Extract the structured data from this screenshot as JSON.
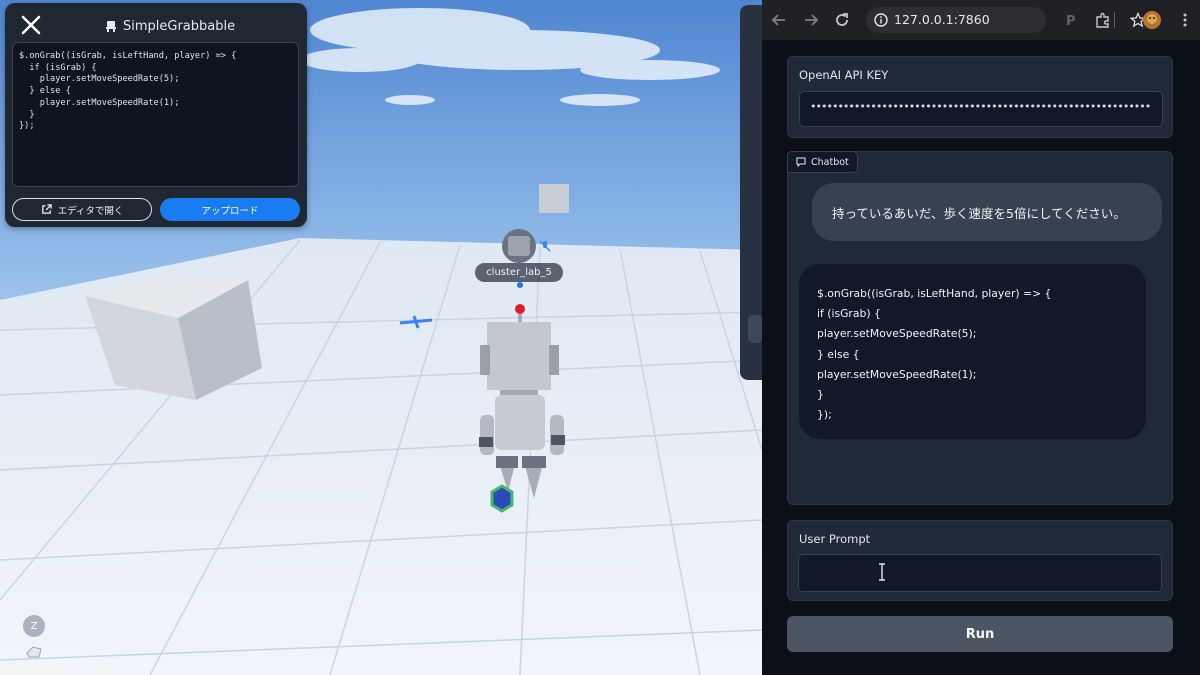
{
  "scene": {
    "grab_panel": {
      "title": "SimpleGrabbable",
      "code": "$.onGrab((isGrab, isLeftHand, player) => {\n  if (isGrab) {\n    player.setMoveSpeedRate(5);\n  } else {\n    player.setMoveSpeedRate(1);\n  }\n});",
      "open_editor_label": "エディタで開く",
      "upload_label": "アップロード",
      "icons": [
        "close-icon",
        "chair-icon",
        "external-link-icon"
      ]
    },
    "player_name": "cluster_lab_5",
    "hud": {
      "z_key": "Z"
    }
  },
  "browser": {
    "url": "127.0.0.1:7860",
    "icons": [
      "back-icon",
      "forward-icon",
      "reload-icon",
      "info-icon",
      "star-icon",
      "extension-p-icon",
      "puzzle-icon",
      "avatar-icon",
      "menu-icon"
    ],
    "api_key": {
      "label": "OpenAI API KEY",
      "value": "••••••••••••••••••••••••••••••••••••••••••••••••••••••••••••••"
    },
    "chatbot": {
      "label": "Chatbot",
      "user_message": "持っているあいだ、歩く速度を5倍にしてください。",
      "bot_message": "$.onGrab((isGrab, isLeftHand, player) => {\nif (isGrab) {\nplayer.setMoveSpeedRate(5);\n} else {\nplayer.setMoveSpeedRate(1);\n}\n});"
    },
    "user_prompt": {
      "label": "User Prompt",
      "value": ""
    },
    "run_label": "Run"
  },
  "colors": {
    "accent": "#1a7cf2",
    "page_bg": "#0b0f17",
    "panel_bg": "#1f2937"
  }
}
